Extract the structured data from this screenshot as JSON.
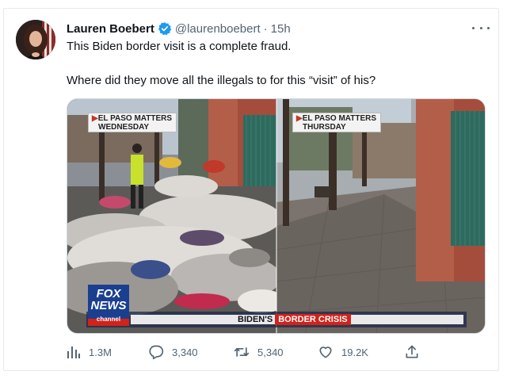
{
  "tweet": {
    "author_name": "Lauren Boebert",
    "handle": "@laurenboebert",
    "separator": "·",
    "time": "15h",
    "text_line1": "This Biden border visit is a complete fraud.",
    "text_line2": "Where did they move all the illegals to for this “visit” of his?"
  },
  "media": {
    "left_label_line1": "EL PASO MATTERS",
    "left_label_line2": "WEDNESDAY",
    "right_label_line1": "EL PASO MATTERS",
    "right_label_line2": "THURSDAY",
    "network_line1": "FOX",
    "network_line2": "NEWS",
    "network_line3": "channel",
    "banner_prefix": "BIDEN'S",
    "banner_highlight": "BORDER CRISIS"
  },
  "actions": {
    "views": "1.3M",
    "replies": "3,340",
    "retweets": "5,340",
    "likes": "19.2K"
  },
  "colors": {
    "verified_blue": "#1d9bf0",
    "muted_text": "#536471",
    "fox_red": "#d3221a",
    "fox_blue": "#1b3f8f"
  },
  "icons": [
    "verified-icon",
    "more-icon",
    "views-icon",
    "reply-icon",
    "retweet-icon",
    "like-icon",
    "share-icon"
  ]
}
